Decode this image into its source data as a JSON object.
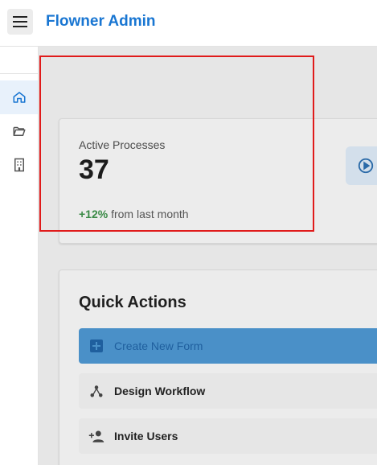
{
  "header": {
    "title": "Flowner Admin",
    "menu_icon": "hamburger-menu-icon"
  },
  "sidebar": {
    "items": [
      {
        "icon": "home-icon",
        "active": true
      },
      {
        "icon": "folder-open-icon",
        "active": false
      },
      {
        "icon": "building-icon",
        "active": false
      }
    ]
  },
  "stat_card": {
    "label": "Active Processes",
    "value": "37",
    "change_value": "+12%",
    "change_text": " from last month",
    "icon": "play-circle-icon"
  },
  "quick_actions": {
    "title": "Quick Actions",
    "items": [
      {
        "label": "Create New Form",
        "icon": "add-box-icon"
      },
      {
        "label": "Design Workflow",
        "icon": "workflow-icon"
      },
      {
        "label": "Invite Users",
        "icon": "person-add-icon"
      }
    ]
  },
  "colors": {
    "brand": "#1976d2",
    "positive": "#3a8a46",
    "highlight": "#e01b1b"
  }
}
